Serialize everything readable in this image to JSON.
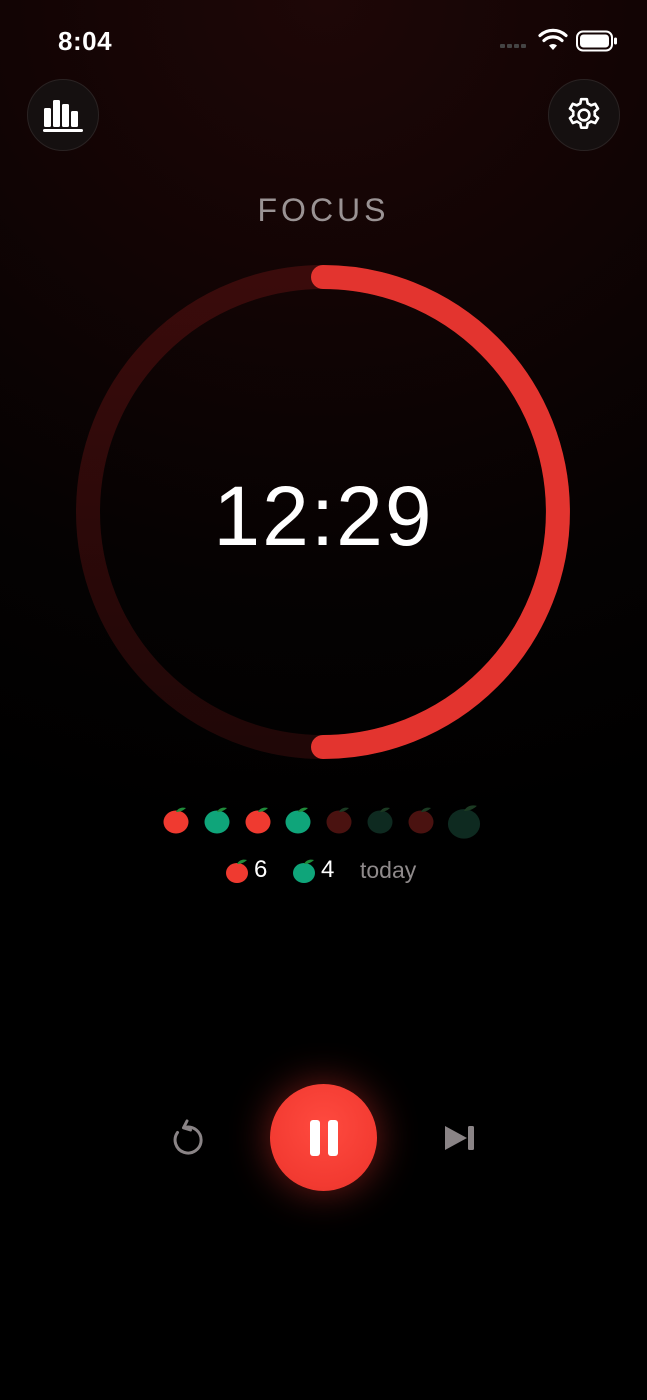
{
  "status_bar": {
    "time": "8:04"
  },
  "header": {
    "stats_icon": "bar-chart-icon",
    "settings_icon": "gear-icon"
  },
  "mode_label": "FOCUS",
  "timer": {
    "remaining": "12:29",
    "progress": 0.5
  },
  "colors": {
    "accent_red": "#e3342f",
    "tomato_red": "#ef3a30",
    "tomato_green": "#0fa57a",
    "ring_track": "#3a0c0c"
  },
  "sessions": [
    {
      "type": "red",
      "state": "done"
    },
    {
      "type": "green",
      "state": "done"
    },
    {
      "type": "red",
      "state": "done"
    },
    {
      "type": "green",
      "state": "done"
    },
    {
      "type": "red",
      "state": "pending"
    },
    {
      "type": "green",
      "state": "pending"
    },
    {
      "type": "red",
      "state": "pending"
    },
    {
      "type": "green",
      "state": "pending-large"
    }
  ],
  "summary": {
    "focus_count": "6",
    "break_count": "4",
    "period": "today"
  },
  "controls": {
    "reset_icon": "reset-icon",
    "pause_icon": "pause-icon",
    "skip_icon": "skip-forward-icon"
  }
}
